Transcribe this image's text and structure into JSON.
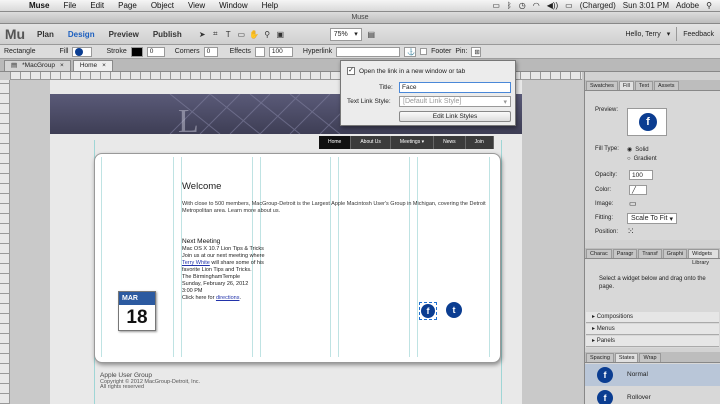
{
  "menubar": {
    "items": [
      "Muse",
      "File",
      "Edit",
      "Page",
      "Object",
      "View",
      "Window",
      "Help"
    ],
    "battery": "(Charged)",
    "clock": "Sun 3:01 PM",
    "user": "Adobe"
  },
  "window": {
    "title": "Muse"
  },
  "appbar": {
    "logo": "Mu",
    "modes": [
      "Plan",
      "Design",
      "Preview",
      "Publish"
    ],
    "zoom": "75%",
    "greeting": "Hello, Terry",
    "feedback": "Feedback"
  },
  "control": {
    "selection": "Rectangle",
    "fill": "Fill",
    "stroke": "Stroke",
    "stroke_value": "0",
    "corners": "Corners",
    "corners_value": "0",
    "effects": "Effects",
    "effects_value": "100",
    "hyperlink": "Hyperlink",
    "footer": "Footer",
    "pin": "Pin:"
  },
  "tabs": [
    {
      "label": "*MacGroup"
    },
    {
      "label": "Home"
    }
  ],
  "hyperlink_popup": {
    "new_window_label": "Open the link in a new window or tab",
    "title_label": "Title:",
    "title_value": "Face",
    "style_label": "Text Link Style:",
    "style_value": "[Default Link Style]",
    "edit_button": "Edit Link Styles"
  },
  "site": {
    "nav": [
      "Home",
      "About Us",
      "Meetings",
      "News",
      "Join"
    ],
    "welcome": "Welcome",
    "intro": "With close to 500 members, MacGroup-Detroit is the Largest Apple Macintosh User's Group in Michigan, covering the Detroit Metropolitan area. Learn more about us.",
    "meeting_title": "Next Meeting",
    "meeting_lines": [
      "Mac OS X 10.7 Lion Tips & Tricks",
      "Join us at our next meeting where",
      "Terry White",
      "will share some of his",
      "favorite Lion Tips and Tricks.",
      "The BirminghamTemple",
      "Sunday, February 26, 2012",
      "3:00 PM",
      "Click here for",
      "directions"
    ],
    "calendar_month": "MAR",
    "calendar_day": "18",
    "facebook_glyph": "f",
    "twitter_glyph": "t",
    "footer_title": "Apple User Group",
    "footer_line1": "Copyright © 2012 MacGroup-Detroit, Inc.",
    "footer_line2": "All rights reserved"
  },
  "panel": {
    "tabs": [
      "Swatches",
      "Fill",
      "Text",
      "Assets"
    ],
    "preview_label": "Preview:",
    "fill_type_label": "Fill Type:",
    "solid": "Solid",
    "gradient": "Gradient",
    "opacity_label": "Opacity:",
    "opacity_value": "100",
    "color_label": "Color:",
    "image_label": "Image:",
    "fitting_label": "Fitting:",
    "fitting_value": "Scale To Fit",
    "position_label": "Position:",
    "tabs2": [
      "Charac",
      "Paragr",
      "Transf",
      "Graphi",
      "Widgets Library"
    ],
    "widget_hint": "Select a widget below and drag onto the page.",
    "sections": [
      "Compositions",
      "Menus",
      "Panels"
    ],
    "tabs3": [
      "Spacing",
      "States",
      "Wrap"
    ],
    "states": [
      "Normal",
      "Rollover"
    ]
  },
  "colors": {
    "accent": "#1c5fbf",
    "facebook": "#0b3d91",
    "nav_bg": "#3b3b3b",
    "calendar": "#2c5aa0"
  }
}
